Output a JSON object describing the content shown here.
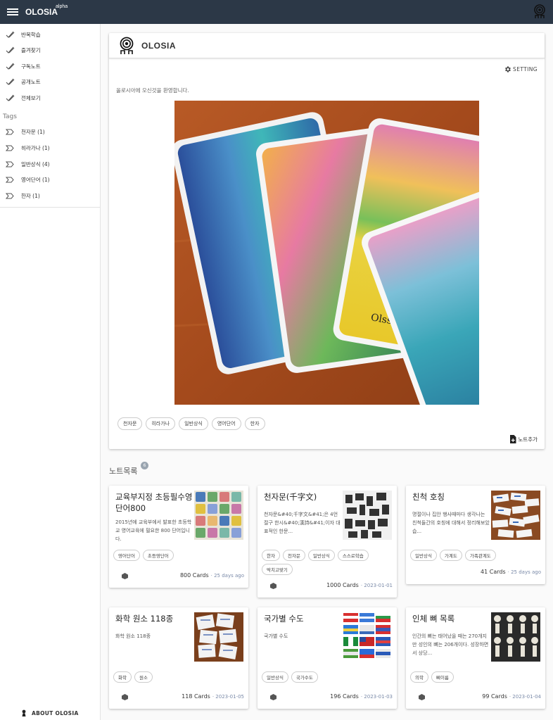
{
  "app": {
    "brand": "OLOSIA",
    "badge": "alpha"
  },
  "sidebar": {
    "items": [
      {
        "label": "반복학습"
      },
      {
        "label": "즐겨찾기"
      },
      {
        "label": "구독노트"
      },
      {
        "label": "공개노트"
      },
      {
        "label": "전체보기"
      }
    ],
    "tags_title": "Tags",
    "tags": [
      {
        "label": "천자문 (1)"
      },
      {
        "label": "히라가나 (1)"
      },
      {
        "label": "일반상식 (4)"
      },
      {
        "label": "영어단어 (1)"
      },
      {
        "label": "한자 (1)"
      }
    ],
    "about_label": "ABOUT OLOSIA"
  },
  "welcome": {
    "title": "OLOSIA",
    "setting_label": "SETTING",
    "message": "올로시아에 오신것을 환영합니다.",
    "tags": [
      "천자문",
      "히라가나",
      "일반상식",
      "영어단어",
      "한자"
    ],
    "add_note_label": "노트추가",
    "card_logo_text": "Olssia"
  },
  "notes_section": {
    "title": "노트목록",
    "badge": "6"
  },
  "notes": [
    {
      "title": "교육부지정 초등필수영단어800",
      "desc": "2015년에 교육부에서 발표한 초등학교 영어교육에 필요한 800 단어입니다.",
      "tags": [
        "영어단어",
        "초등영단어"
      ],
      "cards": "800 Cards",
      "date": "· 25 days ago"
    },
    {
      "title": "천자문(千字文)",
      "desc": "천자문&#40;千字文&#41;은 4언절구 한시&#40;漢詩&#41;이자 대표적인 한문...",
      "tags": [
        "한자",
        "천자문",
        "일반상식",
        "스스로학습",
        "딱치고맞기"
      ],
      "cards": "1000 Cards",
      "date": "· 2023-01-01"
    },
    {
      "title": "친척 호칭",
      "desc": "명절이나 집안 행사때마다 생각나는 친척들간의 호칭에 대해서 정리해보았습...",
      "tags": [
        "일반상식",
        "가계도",
        "가족관계도"
      ],
      "cards": "41 Cards",
      "date": "· 25 days ago"
    },
    {
      "title": "화학 원소 118종",
      "desc": "화학 원소 118종",
      "tags": [
        "화학",
        "원소"
      ],
      "cards": "118 Cards",
      "date": "· 2023-01-05"
    },
    {
      "title": "국가별 수도",
      "desc": "국가별 수도",
      "tags": [
        "일반상식",
        "국가수도"
      ],
      "cards": "196 Cards",
      "date": "· 2023-01-03"
    },
    {
      "title": "인체 뼈 목록",
      "desc": "인간의 뼈는 태어났을 때는 270개지만 성인의 뼈는 206개이다. 성장하면서 상당...",
      "tags": [
        "의학",
        "뼈이름"
      ],
      "cards": "99 Cards",
      "date": "· 2023-01-04"
    }
  ],
  "colors": {
    "topbar": "#2c3847",
    "date": "#7a8aa8",
    "badge": "#9aa5b0"
  }
}
